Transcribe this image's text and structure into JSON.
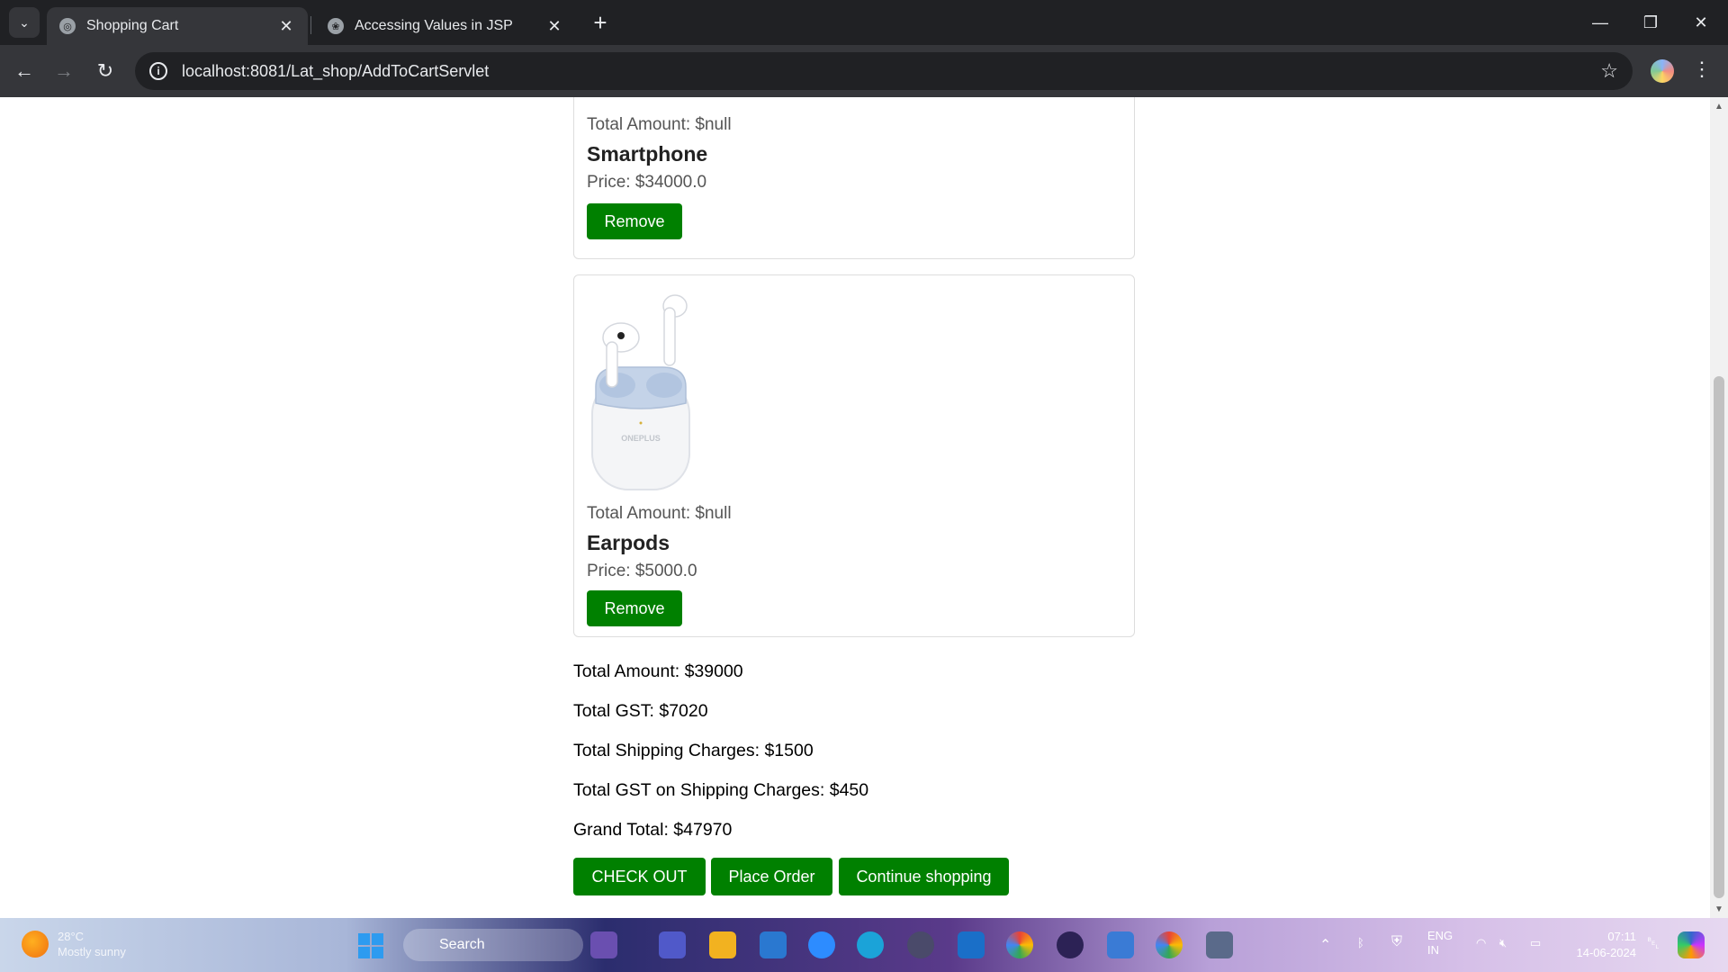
{
  "browser": {
    "tabs": [
      {
        "title": "Shopping Cart",
        "active": true
      },
      {
        "title": "Accessing Values in JSP",
        "active": false
      }
    ],
    "url": "localhost:8081/Lat_shop/AddToCartServlet"
  },
  "cart": {
    "items": [
      {
        "total_amount_label": "Total Amount: $null",
        "name": "Smartphone",
        "price_label": "Price: $34000.0",
        "remove_label": "Remove"
      },
      {
        "total_amount_label": "Total Amount: $null",
        "name": "Earpods",
        "price_label": "Price: $5000.0",
        "remove_label": "Remove",
        "image_brand_text": "ONEPLUS"
      }
    ],
    "summary": {
      "total_amount": "Total Amount: $39000",
      "total_gst": "Total GST: $7020",
      "total_shipping": "Total Shipping Charges: $1500",
      "total_gst_shipping": "Total GST on Shipping Charges: $450",
      "grand_total": "Grand Total: $47970"
    },
    "actions": {
      "checkout": "CHECK OUT",
      "place_order": "Place Order",
      "continue_shopping": "Continue shopping"
    }
  },
  "taskbar": {
    "weather_temp": "28°C",
    "weather_desc": "Mostly sunny",
    "search_label": "Search",
    "lang_top": "ENG",
    "lang_bottom": "IN",
    "time": "07:11",
    "date": "14-06-2024"
  },
  "colors": {
    "accent_green": "#008000",
    "chrome_dark": "#202124",
    "chrome_toolbar": "#35363a"
  }
}
